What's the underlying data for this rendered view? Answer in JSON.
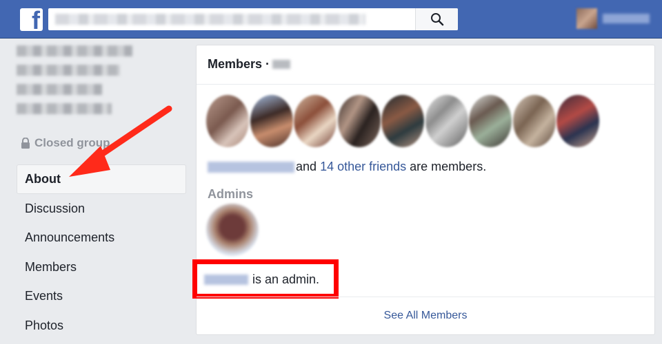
{
  "topbar": {
    "logo_text": "f",
    "search_icon": "search-icon"
  },
  "sidebar": {
    "group_status": "Closed group",
    "items": [
      {
        "label": "About",
        "active": true
      },
      {
        "label": "Discussion",
        "active": false
      },
      {
        "label": "Announcements",
        "active": false
      },
      {
        "label": "Members",
        "active": false
      },
      {
        "label": "Events",
        "active": false
      },
      {
        "label": "Photos",
        "active": false
      }
    ]
  },
  "members_card": {
    "title": "Members ·",
    "friends_line": {
      "middle": "and",
      "link": "14 other friends",
      "suffix": "are members."
    },
    "admins_label": "Admins",
    "admin_text": "is an admin.",
    "footer_link": "See All Members"
  },
  "colors": {
    "topbar": "#4267b2",
    "link": "#365899",
    "highlight": "#ff0000",
    "annotation_arrow": "#ff2a1a"
  }
}
